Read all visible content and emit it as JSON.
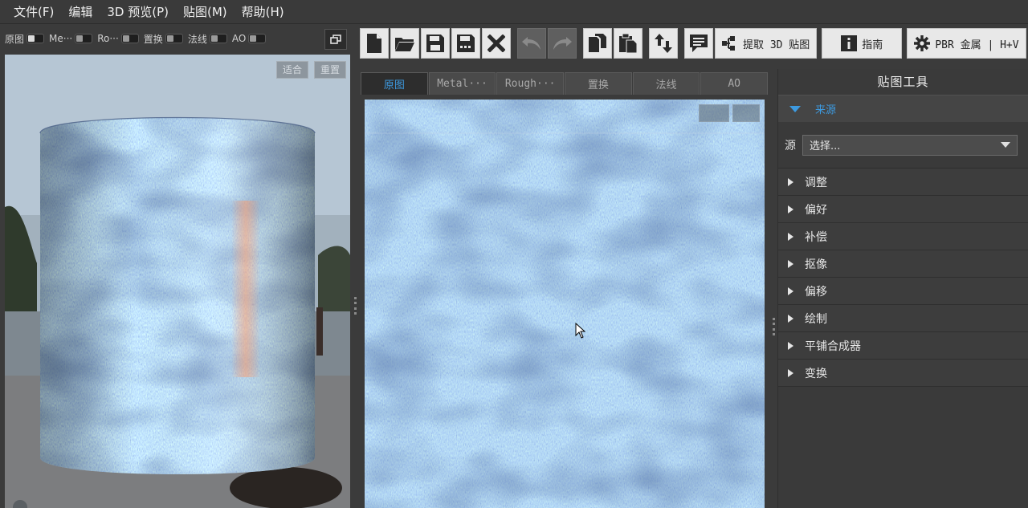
{
  "menu": [
    "文件(F)",
    "编辑",
    "3D 预览(P)",
    "贴图(M)",
    "帮助(H)"
  ],
  "preview_toggles": [
    {
      "label": "原图",
      "on": true
    },
    {
      "label": "Me···",
      "on": false
    },
    {
      "label": "Ro···",
      "on": false
    },
    {
      "label": "置换",
      "on": false
    },
    {
      "label": "法线",
      "on": false
    },
    {
      "label": "AO",
      "on": false
    }
  ],
  "viewport": {
    "fit_label": "适合",
    "reset_label": "重置"
  },
  "toolbar": {
    "icons": [
      "new-file-icon",
      "open-folder-icon",
      "save-icon",
      "save-as-icon",
      "close-icon",
      "undo-icon",
      "redo-icon",
      "copy-icon",
      "paste-icon",
      "swap-icon",
      "comment-icon"
    ],
    "extract_label": "提取 3D 贴图",
    "guide_label": "指南",
    "pbr_label": "PBR 金属 | H+V"
  },
  "map_tabs": [
    "原图",
    "Metal···",
    "Rough···",
    "置换",
    "法线",
    "AO"
  ],
  "active_tab": 0,
  "panel": {
    "title": "贴图工具",
    "source_section": "来源",
    "source_label": "源",
    "source_select_value": "选择...",
    "sections": [
      "调整",
      "偏好",
      "补偿",
      "抠像",
      "偏移",
      "绘制",
      "平铺合成器",
      "变换"
    ]
  },
  "colors": {
    "accent": "#3d9ae0",
    "texture_base": "#5a7fb0"
  }
}
